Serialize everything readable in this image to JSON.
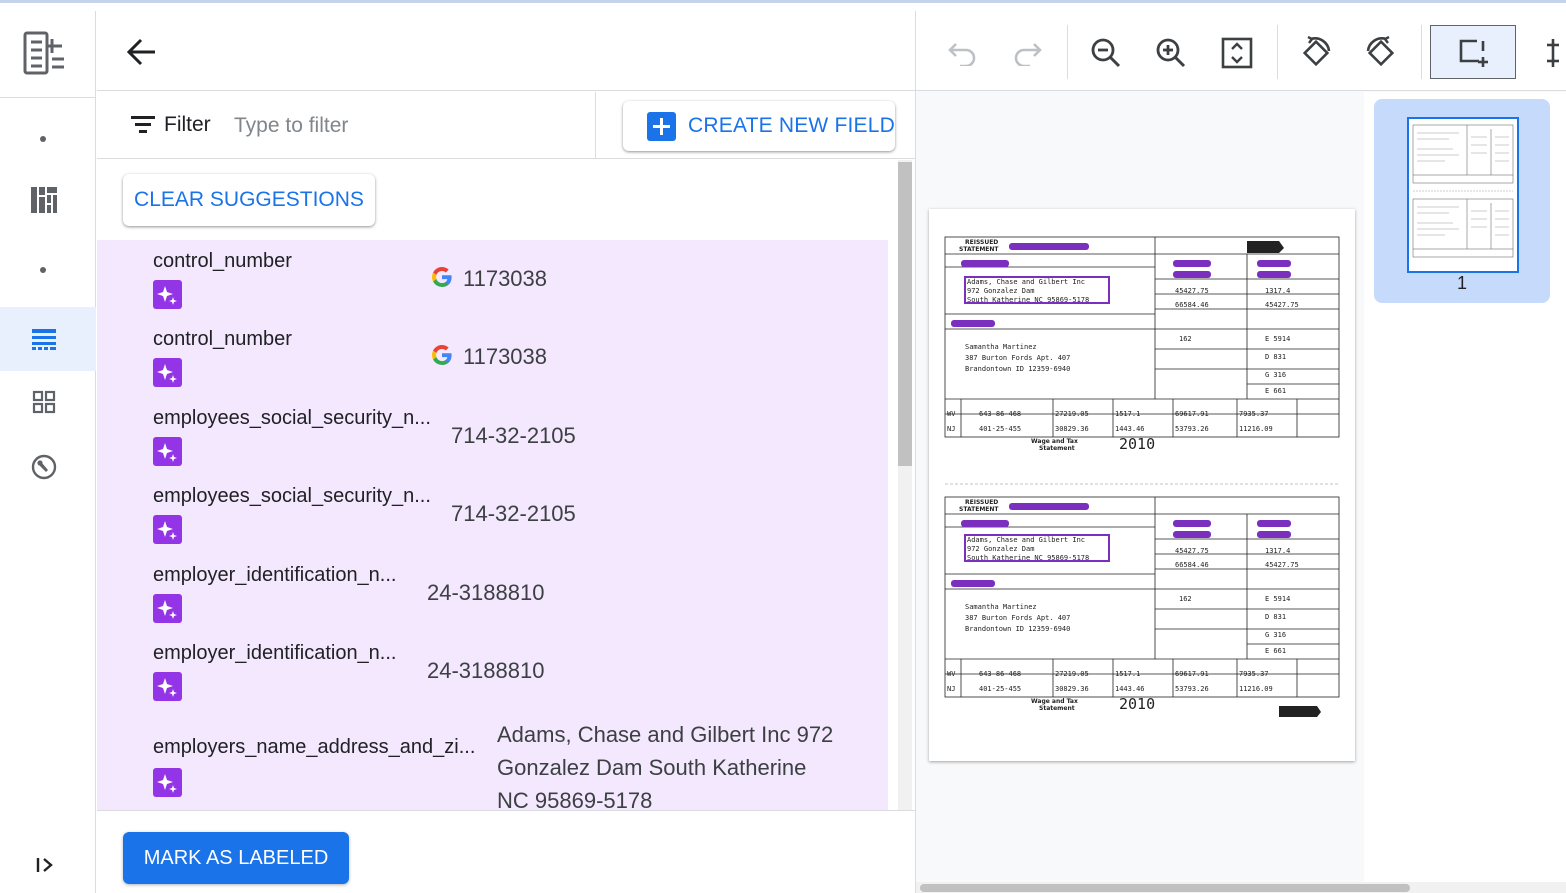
{
  "rail": {
    "items": [
      {
        "icon": "dot-icon"
      },
      {
        "icon": "dashboard-icon"
      },
      {
        "icon": "dot-icon"
      },
      {
        "icon": "fields-list-icon",
        "active": true
      },
      {
        "icon": "grid-icon"
      },
      {
        "icon": "settings-wrench-icon"
      }
    ]
  },
  "filter": {
    "label": "Filter",
    "placeholder": "Type to filter"
  },
  "create_button": {
    "label": "CREATE NEW FIELD"
  },
  "clear_button": {
    "label": "CLEAR SUGGESTIONS"
  },
  "fields": [
    {
      "name": "control_number",
      "value": "1173038",
      "google": true
    },
    {
      "name": "control_number",
      "value": "1173038",
      "google": true
    },
    {
      "name": "employees_social_security_n...",
      "value": "714-32-2105",
      "google": false
    },
    {
      "name": "employees_social_security_n...",
      "value": "714-32-2105",
      "google": false
    },
    {
      "name": "employer_identification_n...",
      "value": "24-3188810",
      "google": false
    },
    {
      "name": "employer_identification_n...",
      "value": "24-3188810",
      "google": false
    },
    {
      "name": "employers_name_address_and_zi...",
      "value": "Adams, Chase and Gilbert Inc 972 Gonzalez Dam South Katherine NC 95869-5178",
      "google": false
    }
  ],
  "mark_button": {
    "label": "MARK AS LABELED"
  },
  "thumbnails": [
    {
      "page": "1"
    }
  ],
  "colors": {
    "accent": "#1a73e8",
    "suggestion_bg": "#f3e8fd",
    "sparkle": "#9334e6"
  }
}
